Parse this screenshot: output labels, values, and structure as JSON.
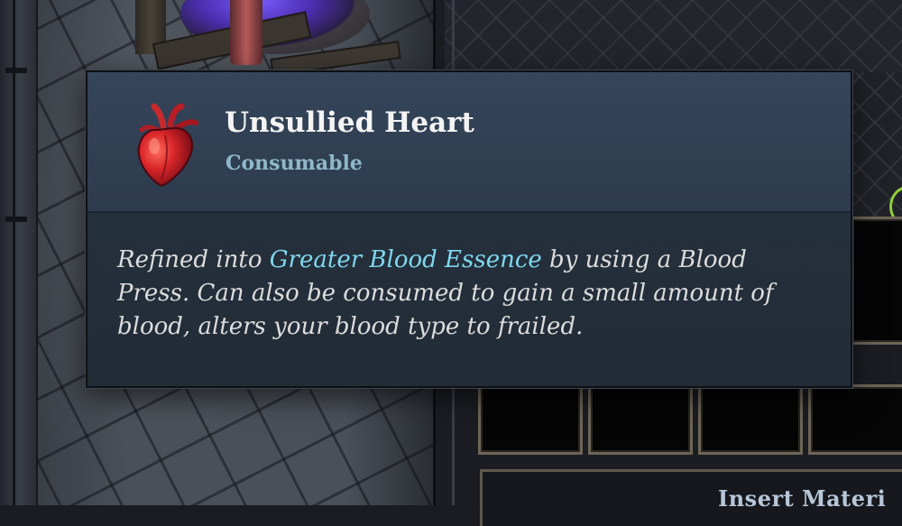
{
  "tooltip": {
    "item_name": "Unsullied Heart",
    "item_type": "Consumable",
    "icon": "heart-icon",
    "description": {
      "before": "Refined into ",
      "highlight": "Greater Blood Essence",
      "after": " by using a Blood Press. Can also be consumed to gain a small amount of blood, alters your blood type to frailed."
    }
  },
  "crafting_panel": {
    "insert_label": "Insert Materi"
  },
  "colors": {
    "highlight": "#7fd7ee",
    "type_text": "#8fb8c9",
    "header_bg": "#35455a",
    "body_bg": "#24303c",
    "ring": "#8fd13a"
  }
}
